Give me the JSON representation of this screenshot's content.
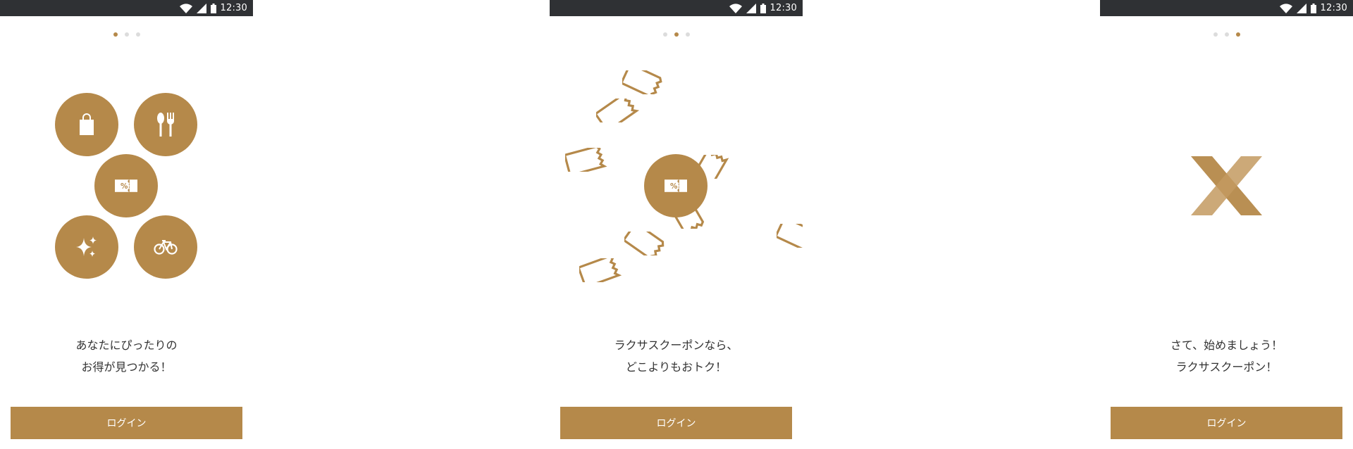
{
  "status_bar": {
    "time": "12:30"
  },
  "colors": {
    "accent": "#b5894a",
    "status_bar_bg": "#2f3134",
    "dot_inactive": "#dcdcdc",
    "text": "#333333"
  },
  "screens": [
    {
      "active_dot": 0,
      "caption": [
        "あなたにぴったりの",
        "お得が見つかる！"
      ],
      "icons": [
        "shopping-bag-icon",
        "restaurant-icon",
        "coupon-icon",
        "sparkle-icon",
        "bicycle-icon"
      ],
      "button_label": "ログイン"
    },
    {
      "active_dot": 1,
      "caption": [
        "ラクサスクーポンなら、",
        "どこよりもおトク！"
      ],
      "icons": [
        "coupon-icon",
        "ticket-outline-icon"
      ],
      "button_label": "ログイン"
    },
    {
      "active_dot": 2,
      "caption": [
        "さて、始めましょう！",
        "ラクサスクーポン！"
      ],
      "icons": [
        "x-logo-icon"
      ],
      "button_label": "ログイン"
    }
  ]
}
